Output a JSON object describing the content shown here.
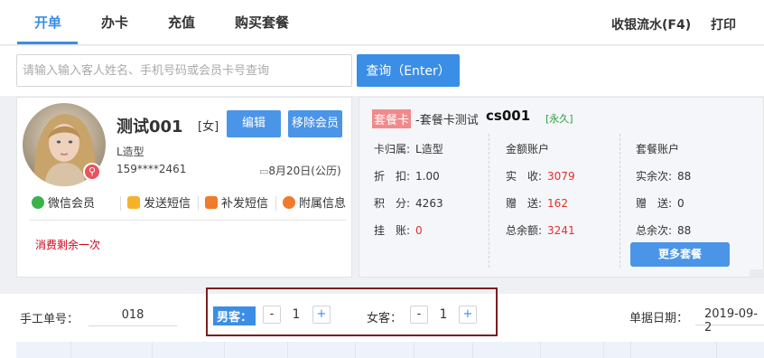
{
  "nav": {
    "tabs": [
      "开单",
      "办卡",
      "充值",
      "购买套餐"
    ],
    "right": [
      "收银流水(F4)",
      "打印"
    ]
  },
  "search": {
    "placeholder": "请输入输入客人姓名、手机号码或会员卡号查询",
    "button": "查询（Enter）"
  },
  "customer": {
    "name": "测试001",
    "gender": "[女]",
    "edit_label": "编辑",
    "remove_label": "移除会员",
    "style": "L造型",
    "phone": "159****2461",
    "birthday": "8月20日(公历)",
    "actions": [
      "微信会员",
      "发送短信",
      "补发短信",
      "附属信息"
    ],
    "note": "消费剩余一次"
  },
  "package": {
    "tag": "套餐卡",
    "title": "-套餐卡测试",
    "code": "cs001",
    "validity": "[永久]",
    "col1": [
      {
        "k": "卡归属:",
        "v": "L造型",
        "red": false
      },
      {
        "k": "折　扣:",
        "v": "1.00",
        "red": false
      },
      {
        "k": "积　分:",
        "v": "4263",
        "red": false
      },
      {
        "k": "挂　账:",
        "v": "0",
        "red": true
      }
    ],
    "col2_header": "金额账户",
    "col2": [
      {
        "k": "实　收:",
        "v": "3079"
      },
      {
        "k": "赠　送:",
        "v": "162"
      },
      {
        "k": "总余额:",
        "v": "3241"
      }
    ],
    "col3_header": "套餐账户",
    "col3": [
      {
        "k": "实余次:",
        "v": "88"
      },
      {
        "k": "赠　送:",
        "v": "0"
      },
      {
        "k": "总余次:",
        "v": "88"
      }
    ],
    "more_label": "更多套餐"
  },
  "order": {
    "manual_label": "手工单号：",
    "manual_value": "018",
    "male_label": "男客：",
    "male_count": "1",
    "female_label": "女客：",
    "female_count": "1",
    "minus": "-",
    "plus": "+",
    "date_label": "单据日期：",
    "date_value": "2019-09-2"
  },
  "colors": {
    "accent": "#3a8ee6",
    "red": "#e0312b",
    "green": "#2a9d3a"
  }
}
